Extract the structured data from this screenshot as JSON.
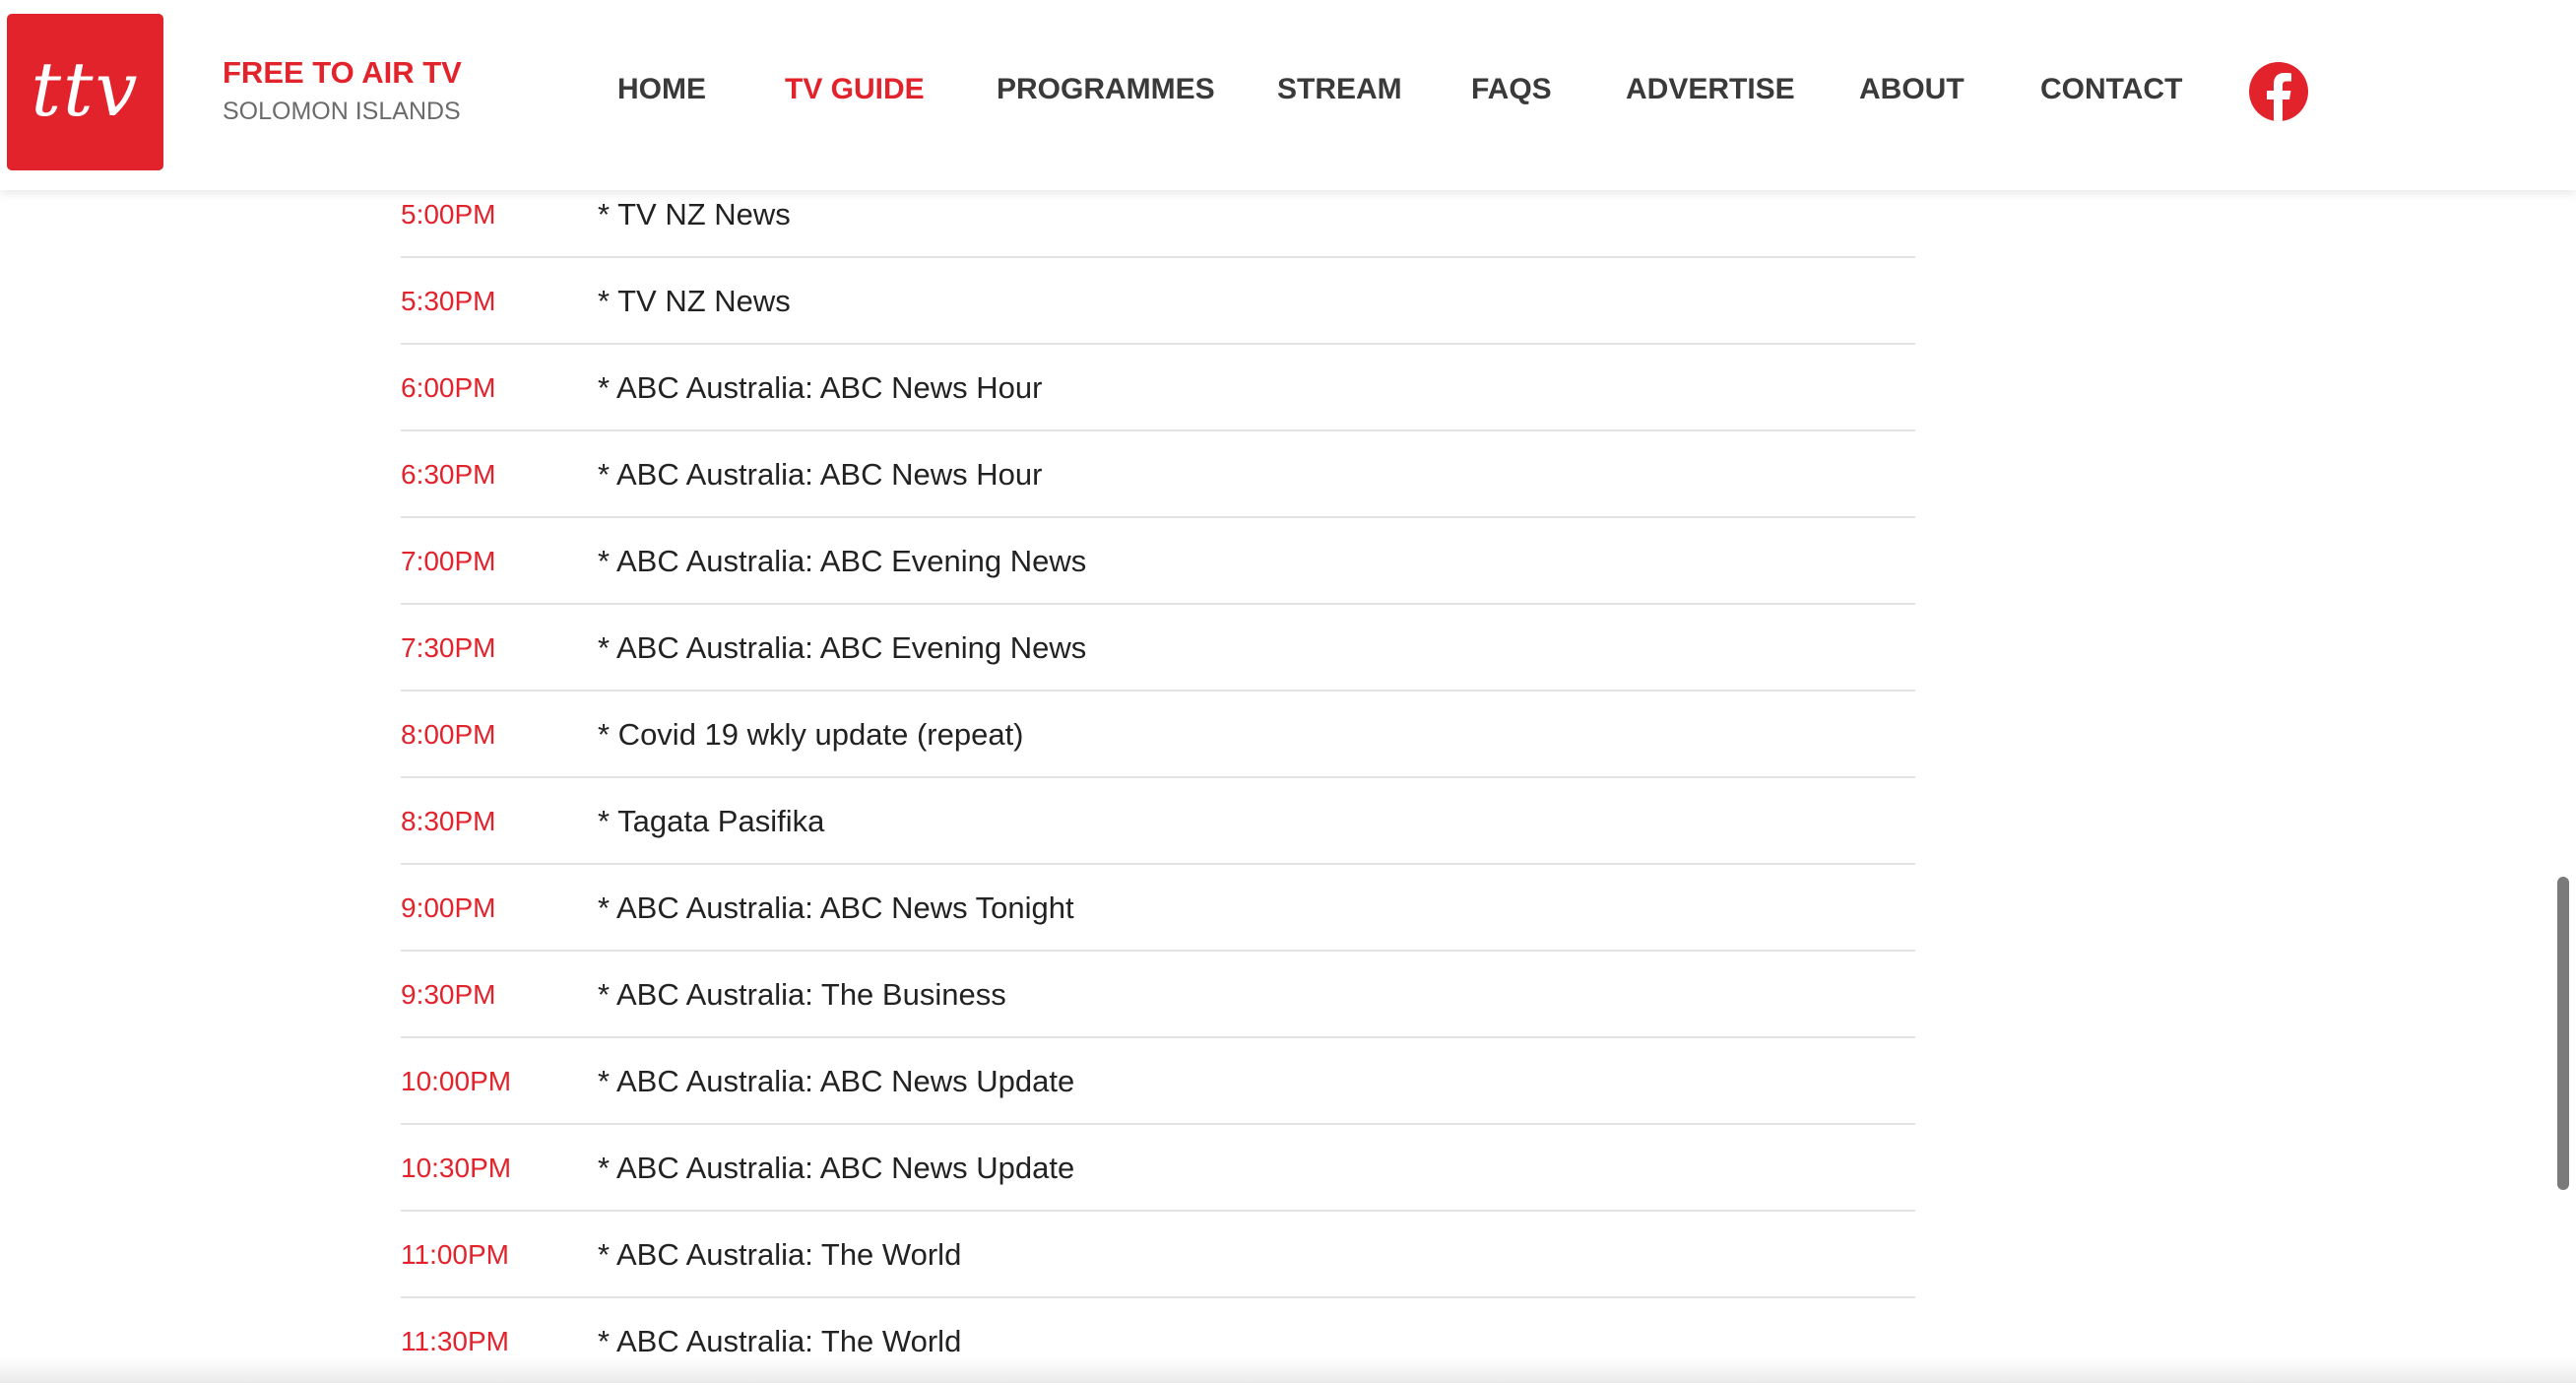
{
  "brand": {
    "logo_text": "ttv",
    "title": "FREE TO AIR TV",
    "subtitle": "SOLOMON ISLANDS"
  },
  "nav": {
    "items": [
      {
        "label": "HOME",
        "active": false
      },
      {
        "label": "TV GUIDE",
        "active": true
      },
      {
        "label": "PROGRAMMES",
        "active": false
      },
      {
        "label": "STREAM",
        "active": false
      },
      {
        "label": "FAQS",
        "active": false
      },
      {
        "label": "ADVERTISE",
        "active": false
      },
      {
        "label": "ABOUT",
        "active": false
      },
      {
        "label": "CONTACT",
        "active": false
      }
    ],
    "social_icon": "facebook-icon"
  },
  "schedule": [
    {
      "time": "5:00PM",
      "program": "* TV NZ News"
    },
    {
      "time": "5:30PM",
      "program": "* TV NZ News"
    },
    {
      "time": "6:00PM",
      "program": "* ABC Australia: ABC News Hour"
    },
    {
      "time": "6:30PM",
      "program": "* ABC Australia: ABC News Hour"
    },
    {
      "time": "7:00PM",
      "program": "* ABC Australia: ABC Evening News"
    },
    {
      "time": "7:30PM",
      "program": "* ABC Australia: ABC Evening News"
    },
    {
      "time": "8:00PM",
      "program": "* Covid 19 wkly update (repeat)"
    },
    {
      "time": "8:30PM",
      "program": "* Tagata Pasifika"
    },
    {
      "time": "9:00PM",
      "program": "* ABC Australia: ABC News Tonight"
    },
    {
      "time": "9:30PM",
      "program": "* ABC Australia: The Business"
    },
    {
      "time": "10:00PM",
      "program": "* ABC Australia: ABC News Update"
    },
    {
      "time": "10:30PM",
      "program": "* ABC Australia: ABC News Update"
    },
    {
      "time": "11:00PM",
      "program": "* ABC Australia: The World"
    },
    {
      "time": "11:30PM",
      "program": "* ABC Australia: The World"
    }
  ],
  "colors": {
    "accent": "#e3232c",
    "nav_text": "#3a3a3a",
    "subtitle_text": "#6b6b6b",
    "divider": "#e3e3e3"
  }
}
